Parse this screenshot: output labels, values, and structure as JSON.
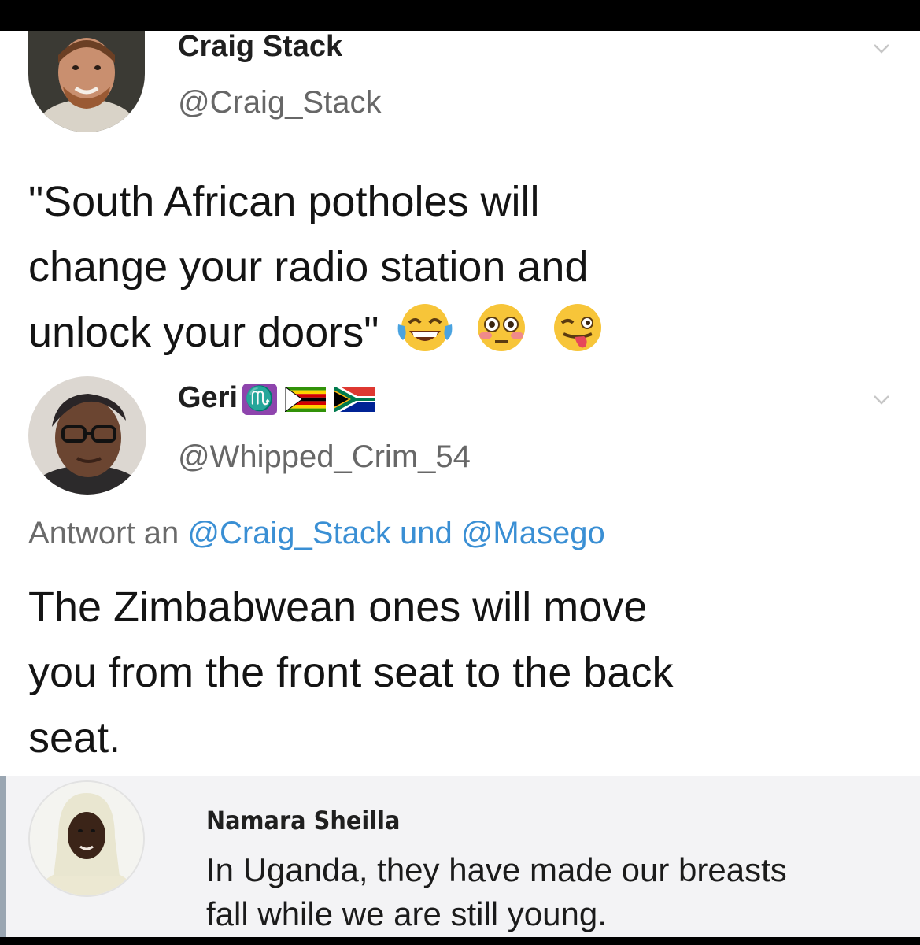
{
  "colors": {
    "link": "#3a8fd4",
    "text": "#141414",
    "handle": "#676767",
    "scorpio_badge": "#8e44ad"
  },
  "tweet1": {
    "name": "Craig Stack",
    "handle": "@Craig_Stack",
    "text_line1": "\"South African potholes will",
    "text_line2": "change your radio station and",
    "text_line3": "unlock your doors\"",
    "emojis": [
      "face-with-tears-of-joy-icon",
      "flushed-face-icon",
      "winking-face-with-tongue-icon"
    ]
  },
  "tweet2": {
    "name": "Geri",
    "name_badges": [
      "scorpio-icon",
      "zimbabwe-flag-icon",
      "south-africa-flag-icon"
    ],
    "scorpio_glyph": "♏",
    "handle": "@Whipped_Crim_54",
    "reply_prefix": "Antwort an",
    "reply_user1": "@Craig_Stack",
    "reply_joiner": "und",
    "reply_user2": "@Masego",
    "text_line1": "The Zimbabwean ones will move",
    "text_line2": "you from the front seat to the back",
    "text_line3": "seat."
  },
  "comment": {
    "name": "Namara Sheilla",
    "text_line1": "In Uganda, they have made our breasts",
    "text_line2": "fall while we are still young."
  }
}
